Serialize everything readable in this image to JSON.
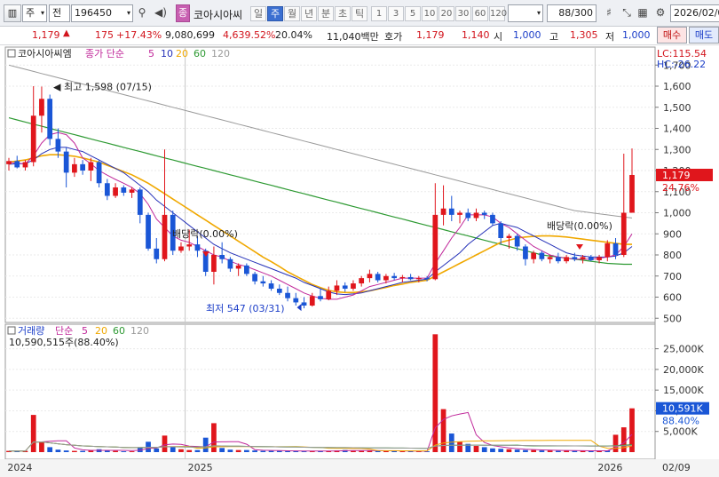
{
  "toolbar": {
    "type_label": "주",
    "cat_label": "전",
    "code": "196450",
    "stock_name": "코아시아씨",
    "period_tabs": [
      "일",
      "주",
      "월",
      "년",
      "분",
      "초",
      "틱"
    ],
    "active_period": "주",
    "intervals": [
      "1",
      "3",
      "5",
      "10",
      "20",
      "30",
      "60",
      "120"
    ],
    "count_value": "88",
    "count_max": "/300",
    "date_value": "2026/02/0"
  },
  "quote": {
    "price": "1,179",
    "change": "175",
    "change_pct": "+17.43%",
    "volume": "9,080,699",
    "volume_pct": "4,639.52%",
    "turnover": "20.04%",
    "amount": "11,040백만",
    "ask_label": "호가",
    "ask_value": "1,179",
    "bid_value": "1,140",
    "open_label": "시",
    "open_value": "1,000",
    "high_label": "고",
    "high_value": "1,305",
    "low_label": "저",
    "low_value": "1,000",
    "buy_label": "매수",
    "sell_label": "매도"
  },
  "price_legend": {
    "name": "코아시아씨엠",
    "ma_label": "종가 단순",
    "ma_periods": [
      "5",
      "10",
      "20",
      "60",
      "120"
    ],
    "lc": "LC:115.54",
    "hc": "HC:-26.22",
    "last_price": "1,179",
    "last_pct": "24.76%"
  },
  "annotations": {
    "high": "최고 1,598 (07/15)",
    "low": "최저 547 (03/31)",
    "dividend1": "배당락(0.00%)",
    "dividend2": "배당락(0.00%)"
  },
  "volume_legend": {
    "label": "거래량",
    "ma_label": "단순",
    "ma_periods": [
      "5",
      "20",
      "60",
      "120"
    ],
    "value": "10,590,515주(88.40%)",
    "last_value": "10,591K",
    "last_pct": "88.40%"
  },
  "x_axis": {
    "labels": [
      "2024",
      "2025",
      "2026"
    ],
    "right_label": "02/09"
  },
  "colors": {
    "up": "#e0161c",
    "down": "#1a56d6",
    "ma5": "#c0289a",
    "ma10": "#2531b8",
    "ma20": "#f0a800",
    "ma60": "#2e9a33",
    "ma120": "#9a9a9a"
  },
  "chart_data": [
    {
      "type": "candlestick",
      "title": "코아시아씨엠 (주봉)",
      "y_ticks": [
        1700,
        1600,
        1500,
        1400,
        1300,
        1200,
        1100,
        1000,
        900,
        800,
        700,
        600,
        500
      ],
      "ylim": [
        480,
        1760
      ],
      "candles": [
        {
          "o": 1230,
          "h": 1260,
          "l": 1200,
          "c": 1245
        },
        {
          "o": 1245,
          "h": 1270,
          "l": 1210,
          "c": 1215
        },
        {
          "o": 1215,
          "h": 1250,
          "l": 1200,
          "c": 1240
        },
        {
          "o": 1240,
          "h": 1600,
          "l": 1220,
          "c": 1460
        },
        {
          "o": 1460,
          "h": 1598,
          "l": 1380,
          "c": 1540
        },
        {
          "o": 1540,
          "h": 1560,
          "l": 1320,
          "c": 1350
        },
        {
          "o": 1350,
          "h": 1400,
          "l": 1260,
          "c": 1290
        },
        {
          "o": 1290,
          "h": 1310,
          "l": 1120,
          "c": 1190
        },
        {
          "o": 1190,
          "h": 1260,
          "l": 1170,
          "c": 1230
        },
        {
          "o": 1230,
          "h": 1250,
          "l": 1180,
          "c": 1200
        },
        {
          "o": 1200,
          "h": 1260,
          "l": 1150,
          "c": 1240
        },
        {
          "o": 1240,
          "h": 1250,
          "l": 1120,
          "c": 1140
        },
        {
          "o": 1140,
          "h": 1160,
          "l": 1060,
          "c": 1080
        },
        {
          "o": 1080,
          "h": 1140,
          "l": 1070,
          "c": 1120
        },
        {
          "o": 1120,
          "h": 1130,
          "l": 1080,
          "c": 1095
        },
        {
          "o": 1095,
          "h": 1120,
          "l": 1070,
          "c": 1110
        },
        {
          "o": 1110,
          "h": 1120,
          "l": 950,
          "c": 990
        },
        {
          "o": 990,
          "h": 1000,
          "l": 820,
          "c": 830
        },
        {
          "o": 830,
          "h": 880,
          "l": 760,
          "c": 780
        },
        {
          "o": 780,
          "h": 1300,
          "l": 770,
          "c": 990
        },
        {
          "o": 990,
          "h": 1010,
          "l": 800,
          "c": 820
        },
        {
          "o": 820,
          "h": 860,
          "l": 810,
          "c": 840
        },
        {
          "o": 840,
          "h": 920,
          "l": 820,
          "c": 850
        },
        {
          "o": 850,
          "h": 890,
          "l": 790,
          "c": 820
        },
        {
          "o": 820,
          "h": 830,
          "l": 700,
          "c": 720
        },
        {
          "o": 720,
          "h": 840,
          "l": 660,
          "c": 800
        },
        {
          "o": 800,
          "h": 860,
          "l": 760,
          "c": 780
        },
        {
          "o": 780,
          "h": 790,
          "l": 720,
          "c": 735
        },
        {
          "o": 735,
          "h": 760,
          "l": 700,
          "c": 750
        },
        {
          "o": 750,
          "h": 760,
          "l": 700,
          "c": 710
        },
        {
          "o": 710,
          "h": 720,
          "l": 660,
          "c": 675
        },
        {
          "o": 675,
          "h": 700,
          "l": 650,
          "c": 665
        },
        {
          "o": 665,
          "h": 680,
          "l": 630,
          "c": 640
        },
        {
          "o": 640,
          "h": 660,
          "l": 610,
          "c": 620
        },
        {
          "o": 620,
          "h": 650,
          "l": 580,
          "c": 595
        },
        {
          "o": 595,
          "h": 620,
          "l": 560,
          "c": 575
        },
        {
          "o": 575,
          "h": 600,
          "l": 547,
          "c": 560
        },
        {
          "o": 560,
          "h": 620,
          "l": 555,
          "c": 605
        },
        {
          "o": 605,
          "h": 640,
          "l": 580,
          "c": 590
        },
        {
          "o": 590,
          "h": 650,
          "l": 585,
          "c": 630
        },
        {
          "o": 630,
          "h": 680,
          "l": 610,
          "c": 655
        },
        {
          "o": 655,
          "h": 670,
          "l": 625,
          "c": 640
        },
        {
          "o": 640,
          "h": 680,
          "l": 630,
          "c": 665
        },
        {
          "o": 665,
          "h": 700,
          "l": 650,
          "c": 690
        },
        {
          "o": 690,
          "h": 730,
          "l": 670,
          "c": 710
        },
        {
          "o": 710,
          "h": 720,
          "l": 670,
          "c": 680
        },
        {
          "o": 680,
          "h": 710,
          "l": 665,
          "c": 700
        },
        {
          "o": 700,
          "h": 715,
          "l": 680,
          "c": 690
        },
        {
          "o": 690,
          "h": 705,
          "l": 670,
          "c": 695
        },
        {
          "o": 695,
          "h": 710,
          "l": 680,
          "c": 685
        },
        {
          "o": 685,
          "h": 700,
          "l": 670,
          "c": 690
        },
        {
          "o": 690,
          "h": 700,
          "l": 675,
          "c": 685
        },
        {
          "o": 685,
          "h": 1140,
          "l": 680,
          "c": 990
        },
        {
          "o": 990,
          "h": 1130,
          "l": 940,
          "c": 1020
        },
        {
          "o": 1020,
          "h": 1080,
          "l": 960,
          "c": 990
        },
        {
          "o": 990,
          "h": 1010,
          "l": 950,
          "c": 1000
        },
        {
          "o": 1000,
          "h": 1020,
          "l": 960,
          "c": 975
        },
        {
          "o": 975,
          "h": 1020,
          "l": 960,
          "c": 1000
        },
        {
          "o": 1000,
          "h": 1010,
          "l": 970,
          "c": 990
        },
        {
          "o": 990,
          "h": 1000,
          "l": 940,
          "c": 950
        },
        {
          "o": 950,
          "h": 960,
          "l": 850,
          "c": 880
        },
        {
          "o": 880,
          "h": 900,
          "l": 830,
          "c": 890
        },
        {
          "o": 890,
          "h": 900,
          "l": 820,
          "c": 840
        },
        {
          "o": 840,
          "h": 850,
          "l": 750,
          "c": 780
        },
        {
          "o": 780,
          "h": 820,
          "l": 760,
          "c": 810
        },
        {
          "o": 810,
          "h": 820,
          "l": 770,
          "c": 780
        },
        {
          "o": 780,
          "h": 800,
          "l": 760,
          "c": 790
        },
        {
          "o": 790,
          "h": 810,
          "l": 760,
          "c": 770
        },
        {
          "o": 770,
          "h": 800,
          "l": 760,
          "c": 790
        },
        {
          "o": 790,
          "h": 810,
          "l": 770,
          "c": 780
        },
        {
          "o": 780,
          "h": 800,
          "l": 760,
          "c": 790
        },
        {
          "o": 790,
          "h": 800,
          "l": 770,
          "c": 775
        },
        {
          "o": 775,
          "h": 800,
          "l": 760,
          "c": 790
        },
        {
          "o": 790,
          "h": 870,
          "l": 770,
          "c": 855
        },
        {
          "o": 855,
          "h": 880,
          "l": 780,
          "c": 800
        },
        {
          "o": 800,
          "h": 1280,
          "l": 790,
          "c": 1000
        },
        {
          "o": 1000,
          "h": 1305,
          "l": 1000,
          "c": 1179
        }
      ],
      "ma": {
        "ma5": [
          1240,
          1235,
          1232,
          1270,
          1330,
          1370,
          1380,
          1370,
          1330,
          1260,
          1232,
          1200,
          1178,
          1158,
          1140,
          1120,
          1090,
          1040,
          970,
          930,
          890,
          870,
          860,
          840,
          820,
          800,
          790,
          770,
          755,
          745,
          730,
          715,
          700,
          680,
          660,
          640,
          620,
          605,
          595,
          590,
          590,
          600,
          610,
          630,
          650,
          660,
          670,
          680,
          690,
          690,
          690,
          690,
          760,
          820,
          880,
          930,
          990,
          990,
          990,
          980,
          950,
          930,
          900,
          870,
          840,
          820,
          800,
          790,
          785,
          780,
          780,
          780,
          785,
          790,
          800,
          840,
          900
        ],
        "ma10": [
          1230,
          1232,
          1233,
          1250,
          1280,
          1300,
          1310,
          1310,
          1300,
          1290,
          1270,
          1250,
          1230,
          1210,
          1190,
          1160,
          1130,
          1100,
          1060,
          1030,
          1000,
          970,
          940,
          910,
          880,
          850,
          830,
          810,
          795,
          780,
          765,
          750,
          735,
          720,
          705,
          690,
          670,
          655,
          640,
          625,
          615,
          612,
          615,
          620,
          630,
          640,
          650,
          660,
          670,
          675,
          680,
          685,
          720,
          750,
          780,
          810,
          850,
          880,
          910,
          940,
          950,
          940,
          930,
          910,
          890,
          870,
          850,
          830,
          810,
          800,
          795,
          790,
          790,
          790,
          795,
          810,
          840
        ],
        "ma20": [
          1240,
          1245,
          1250,
          1260,
          1270,
          1275,
          1275,
          1272,
          1268,
          1260,
          1250,
          1240,
          1225,
          1210,
          1195,
          1180,
          1160,
          1140,
          1115,
          1090,
          1065,
          1040,
          1015,
          990,
          965,
          940,
          915,
          890,
          865,
          840,
          815,
          790,
          768,
          745,
          720,
          700,
          680,
          660,
          645,
          632,
          625,
          622,
          622,
          625,
          630,
          638,
          646,
          655,
          662,
          670,
          675,
          680,
          700,
          720,
          740,
          760,
          780,
          800,
          820,
          840,
          860,
          870,
          880,
          885,
          888,
          890,
          890,
          888,
          885,
          880,
          875,
          870,
          865,
          860,
          855,
          850,
          850
        ],
        "ma60": [
          1450,
          1440,
          1430,
          1420,
          1410,
          1400,
          1390,
          1380,
          1370,
          1360,
          1350,
          1340,
          1330,
          1320,
          1310,
          1300,
          1290,
          1280,
          1270,
          1260,
          1250,
          1240,
          1230,
          1220,
          1210,
          1200,
          1190,
          1180,
          1170,
          1160,
          1150,
          1140,
          1130,
          1120,
          1110,
          1100,
          1090,
          1080,
          1070,
          1060,
          1050,
          1040,
          1030,
          1020,
          1010,
          1000,
          990,
          980,
          970,
          960,
          950,
          940,
          930,
          920,
          910,
          900,
          890,
          880,
          870,
          860,
          850,
          840,
          830,
          820,
          810,
          800,
          795,
          790,
          785,
          780,
          775,
          770,
          765,
          760,
          758,
          756,
          756
        ],
        "ma120": [
          1700,
          1690,
          1680,
          1670,
          1660,
          1650,
          1640,
          1630,
          1620,
          1610,
          1600,
          1590,
          1580,
          1570,
          1560,
          1550,
          1540,
          1530,
          1520,
          1510,
          1500,
          1490,
          1480,
          1470,
          1460,
          1450,
          1440,
          1430,
          1420,
          1410,
          1400,
          1390,
          1380,
          1370,
          1360,
          1350,
          1340,
          1330,
          1320,
          1310,
          1300,
          1290,
          1280,
          1270,
          1260,
          1250,
          1240,
          1230,
          1220,
          1210,
          1200,
          1190,
          1180,
          1170,
          1160,
          1150,
          1140,
          1130,
          1120,
          1110,
          1100,
          1090,
          1080,
          1070,
          1060,
          1050,
          1040,
          1030,
          1020,
          1010,
          1005,
          1000,
          995,
          990,
          985,
          980,
          975
        ]
      }
    },
    {
      "type": "bar",
      "title": "거래량",
      "y_ticks": [
        25000,
        20000,
        15000,
        10000,
        5000
      ],
      "y_unit": "K",
      "ylim": [
        0,
        29000
      ],
      "values": [
        300,
        200,
        300,
        9000,
        2500,
        1200,
        600,
        400,
        300,
        300,
        500,
        700,
        400,
        300,
        200,
        200,
        1200,
        2500,
        900,
        4000,
        1200,
        700,
        500,
        500,
        3500,
        7000,
        1000,
        600,
        500,
        500,
        400,
        300,
        300,
        300,
        300,
        300,
        200,
        200,
        300,
        300,
        400,
        500,
        300,
        300,
        400,
        300,
        300,
        300,
        200,
        200,
        200,
        200,
        28500,
        10400,
        4500,
        2500,
        2000,
        1500,
        1200,
        900,
        800,
        700,
        600,
        500,
        500,
        400,
        400,
        300,
        400,
        300,
        300,
        300,
        300,
        400,
        4200,
        6000,
        10591
      ],
      "up": [
        true,
        false,
        true,
        true,
        true,
        false,
        false,
        false,
        true,
        false,
        true,
        false,
        false,
        true,
        false,
        true,
        false,
        false,
        false,
        true,
        false,
        true,
        true,
        false,
        false,
        true,
        false,
        false,
        true,
        false,
        false,
        false,
        false,
        false,
        false,
        false,
        false,
        true,
        false,
        true,
        true,
        false,
        true,
        true,
        true,
        false,
        true,
        false,
        true,
        false,
        true,
        false,
        true,
        true,
        false,
        true,
        false,
        true,
        false,
        false,
        false,
        true,
        false,
        false,
        true,
        false,
        true,
        false,
        true,
        false,
        true,
        false,
        true,
        false,
        true,
        true,
        true
      ]
    }
  ]
}
